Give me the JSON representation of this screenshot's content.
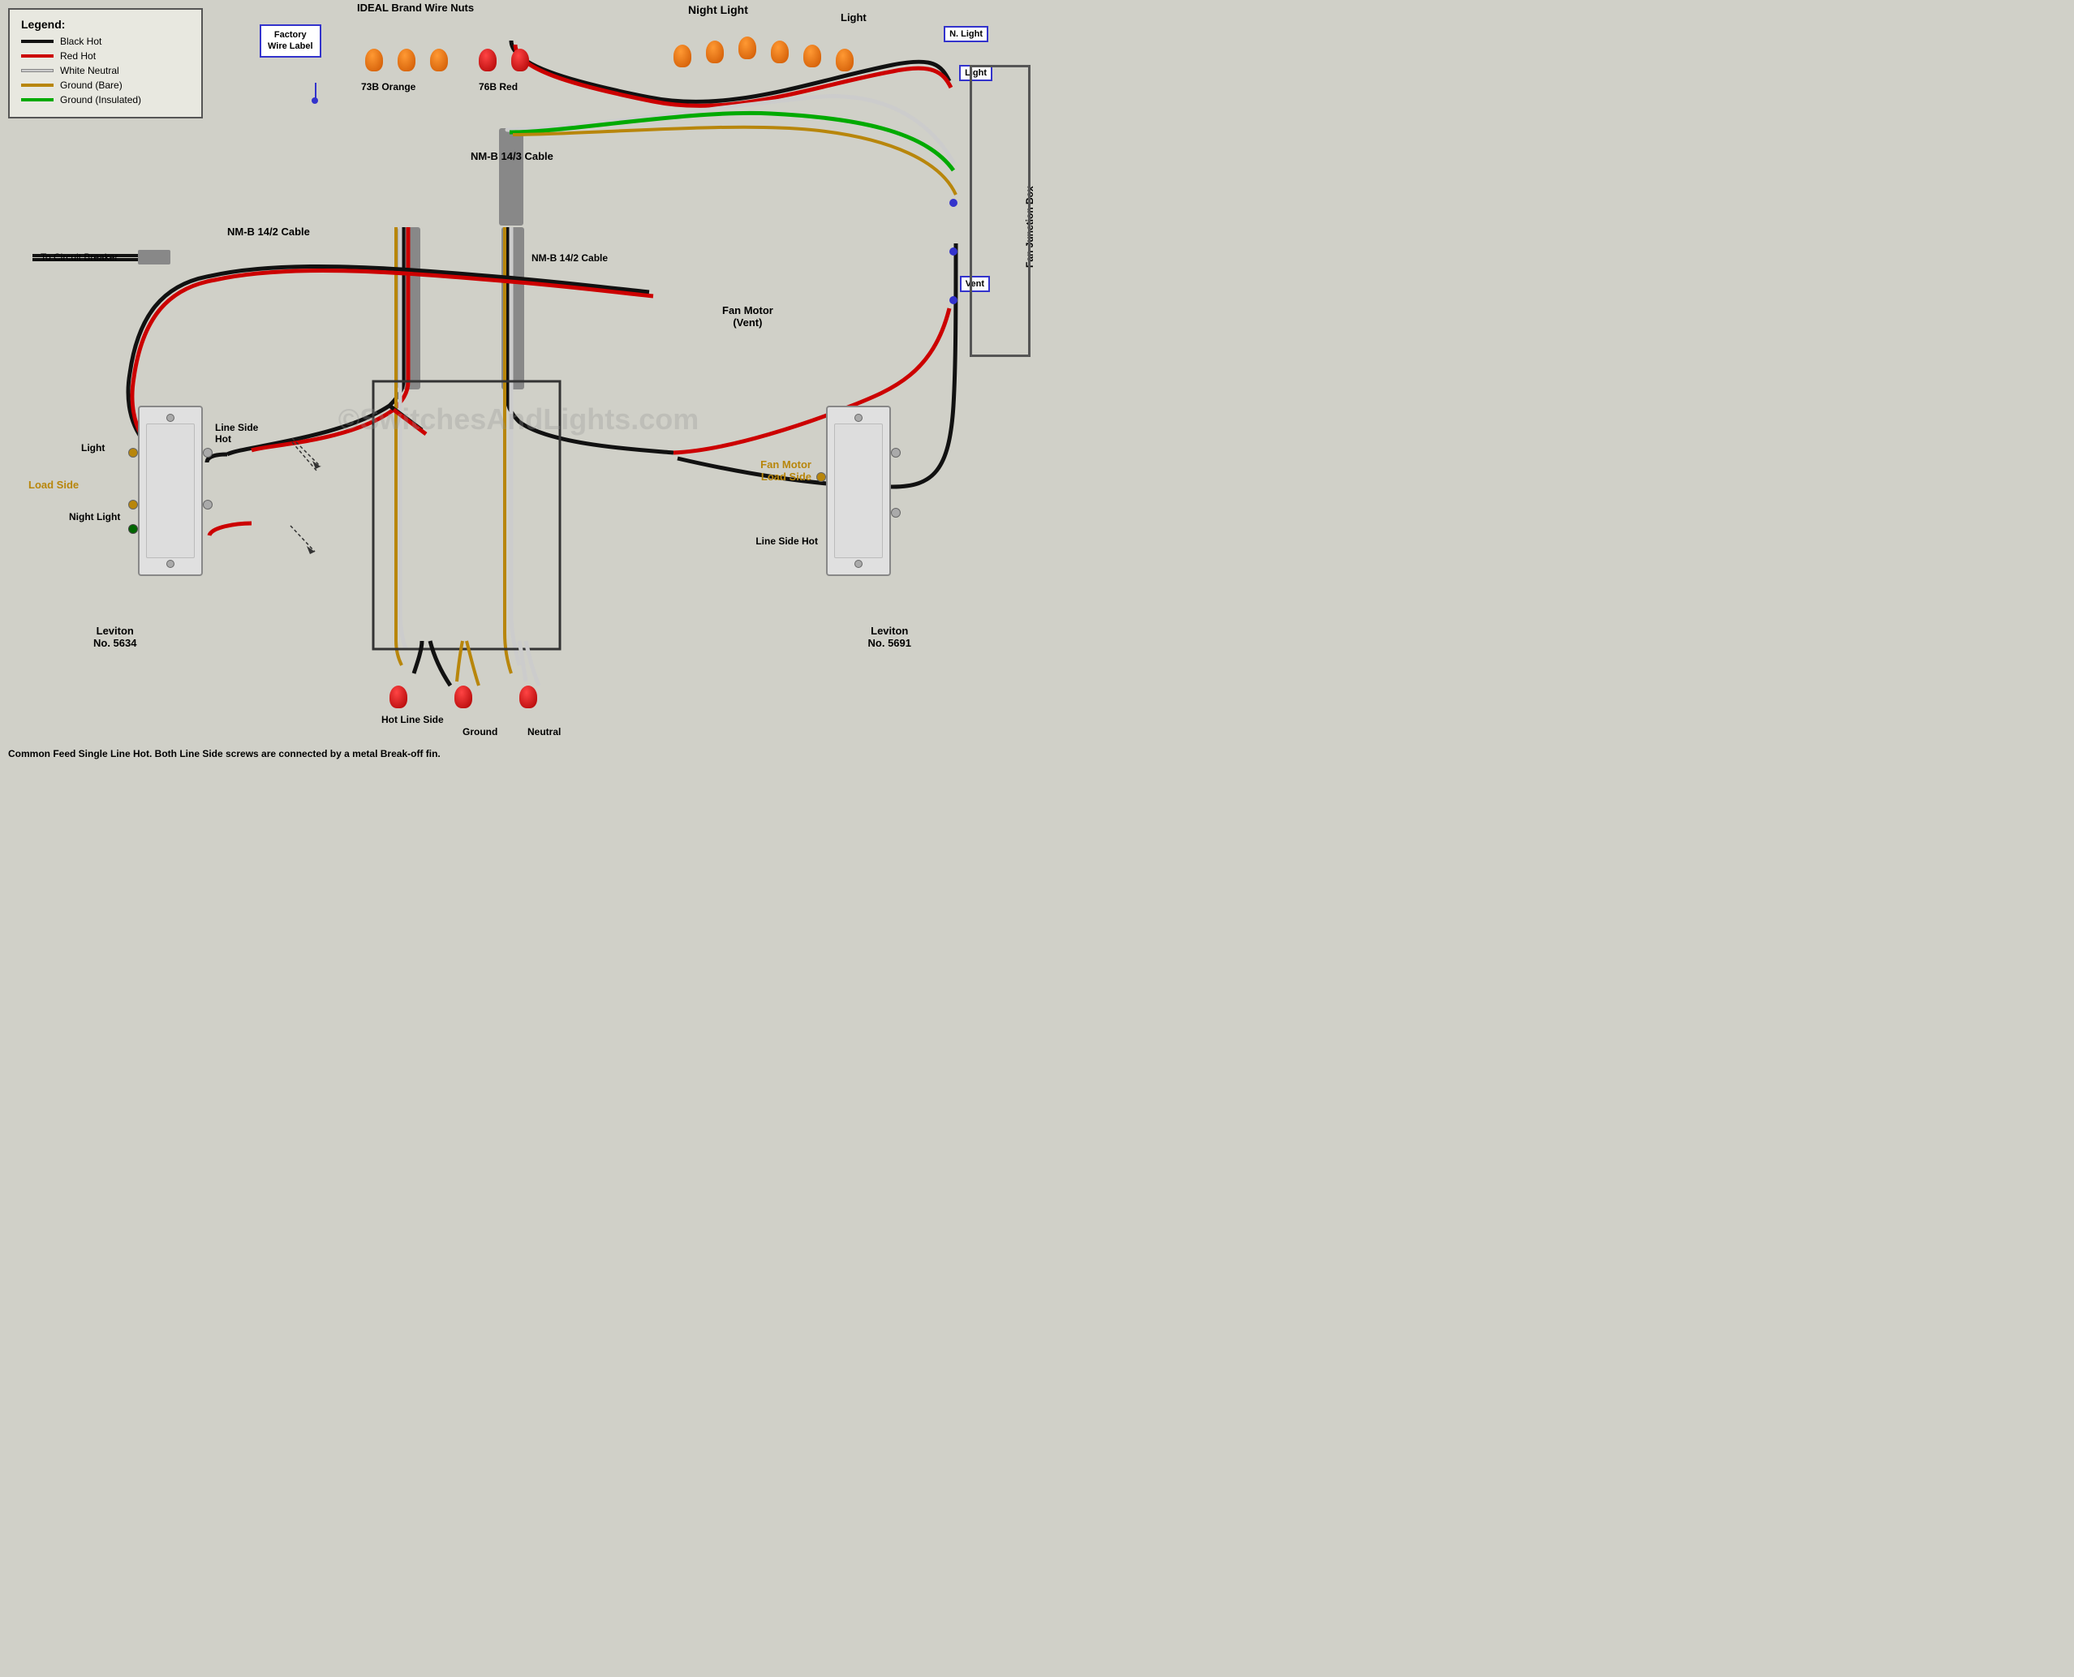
{
  "legend": {
    "title": "Legend:",
    "items": [
      {
        "label": "Black Hot",
        "color": "black"
      },
      {
        "label": "Red Hot",
        "color": "red"
      },
      {
        "label": "White Neutral",
        "color": "white"
      },
      {
        "label": "Ground (Bare)",
        "color": "tan"
      },
      {
        "label": "Ground (Insulated)",
        "color": "green"
      }
    ]
  },
  "factory_label": {
    "line1": "Factory",
    "line2": "Wire Label"
  },
  "ideal_brand": {
    "title": "IDEAL Brand Wire Nuts",
    "orange": "73B Orange",
    "red": "76B Red"
  },
  "cable_labels": {
    "nm_b_143": "NM-B 14/3 Cable",
    "nm_b_142_top": "NM-B 14/2 Cable",
    "nm_b_142_right": "NM-B 14/2\nCable"
  },
  "night_light_label": "Night Light",
  "light_label_top": "Light",
  "n_light_label": "N. Light",
  "light_label_right": "Light",
  "circuit_breaker": "To Circuit Breaker",
  "fan_motor": "Fan Motor\n(Vent)",
  "vent_label": "Vent",
  "switch_left": {
    "light_label": "Light",
    "night_light_label": "Night Light",
    "load_side": "Load Side",
    "line_side_hot": "Line Side\nHot",
    "model": "Leviton\nNo. 5634"
  },
  "switch_right": {
    "fan_motor_load": "Fan Motor\nLoad Side",
    "line_side_hot": "Line Side\nHot",
    "model": "Leviton\nNo. 5691"
  },
  "bottom_labels": {
    "hot_line_side": "Hot\nLine Side",
    "ground": "Ground",
    "neutral": "Neutral"
  },
  "common_feed": "Common Feed Single Line Hot.\nBoth Line Side screws are\nconnected by a metal Break-off fin.",
  "fan_junction_box": "Fan Junction Box",
  "watermark": "©SwitchesAndLights.com"
}
